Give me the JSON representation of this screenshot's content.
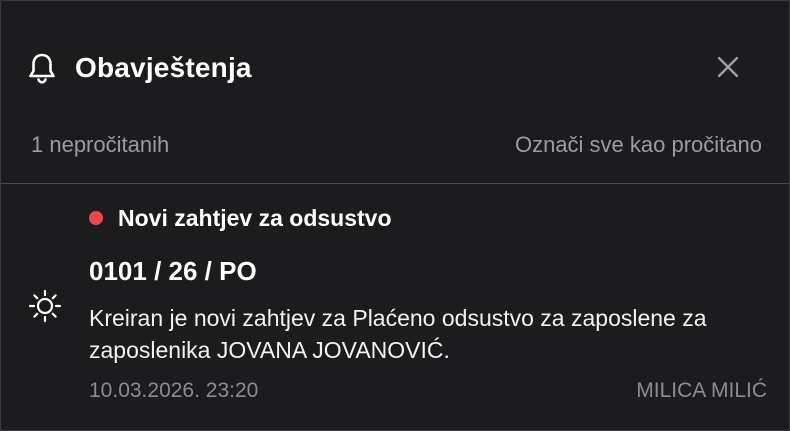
{
  "header": {
    "title": "Obavještenja",
    "bell_icon": "bell-icon",
    "close_icon": "close-icon"
  },
  "subbar": {
    "unread_count": "1 nepročitanih",
    "mark_all_read": "Označi sve kao pročitano"
  },
  "notifications": [
    {
      "unread": true,
      "title": "Novi zahtjev za odsustvo",
      "reference": "0101 / 26 / PO",
      "message": "Kreiran je novi zahtjev za Plaćeno odsustvo za zaposlene za zaposlenika JOVANA JOVANOVIĆ.",
      "timestamp": "10.03.2026. 23:20",
      "author": "MILICA MILIĆ",
      "icon": "sun-icon"
    }
  ],
  "colors": {
    "background": "#1c1c1e",
    "border": "#3a3a3c",
    "unread_dot": "#e5484d",
    "muted_text": "#9c9ca0"
  }
}
